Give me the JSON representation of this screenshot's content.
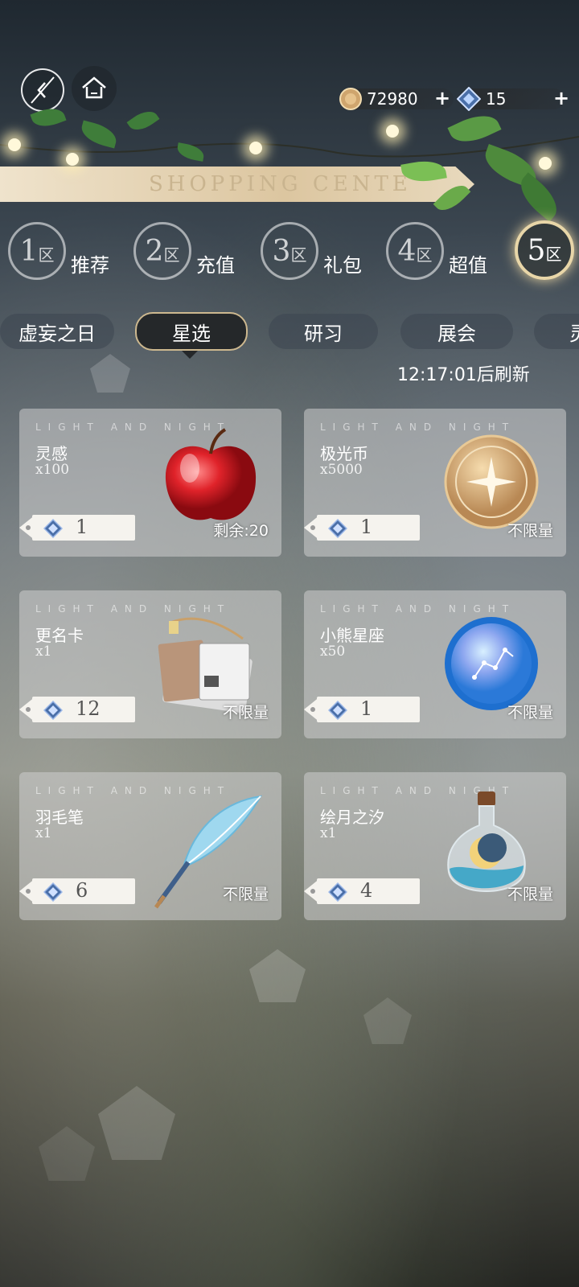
{
  "header": {
    "gold_amount": "72980",
    "gem_amount": "15",
    "plus_symbol": "+",
    "banner_title": "SHOPPING CENTE"
  },
  "zones": [
    {
      "number": "1",
      "suffix": "区",
      "label": "推荐"
    },
    {
      "number": "2",
      "suffix": "区",
      "label": "充值"
    },
    {
      "number": "3",
      "suffix": "区",
      "label": "礼包"
    },
    {
      "number": "4",
      "suffix": "区",
      "label": "超值"
    },
    {
      "number": "5",
      "suffix": "区",
      "label": ""
    }
  ],
  "tabs": [
    "虚妄之日",
    "星选",
    "研习",
    "展会",
    "灵"
  ],
  "active_tab": "星选",
  "refresh_text": "12:17:01后刷新",
  "brand_text": "LIGHT AND NIGHT",
  "items": [
    {
      "name": "灵感",
      "qty": "x100",
      "price": "1",
      "stock": "剩余:20",
      "icon": "apple-icon"
    },
    {
      "name": "极光币",
      "qty": "x5000",
      "price": "1",
      "stock": "不限量",
      "icon": "gold-coin-icon"
    },
    {
      "name": "更名卡",
      "qty": "x1",
      "price": "12",
      "stock": "不限量",
      "icon": "id-card-icon"
    },
    {
      "name": "小熊星座",
      "qty": "x50",
      "price": "1",
      "stock": "不限量",
      "icon": "star-coin-icon"
    },
    {
      "name": "羽毛笔",
      "qty": "x1",
      "price": "6",
      "stock": "不限量",
      "icon": "quill-pen-icon"
    },
    {
      "name": "绘月之汐",
      "qty": "x1",
      "price": "4",
      "stock": "不限量",
      "icon": "moon-potion-icon"
    }
  ],
  "colors": {
    "accent_gold": "#cdb88f",
    "card_bg": "#cdcdcd",
    "tag_bg": "#f5f3ee"
  }
}
